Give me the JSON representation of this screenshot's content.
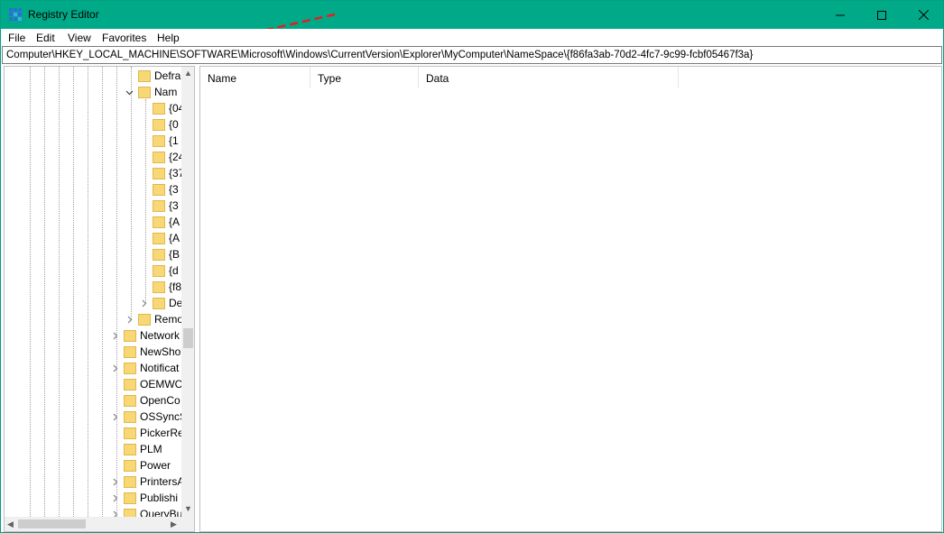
{
  "window": {
    "title": "Registry Editor",
    "titlebar_color": "#00aa88",
    "controls": [
      "minimize-icon",
      "maximize-icon",
      "close-icon"
    ]
  },
  "menu": {
    "items": [
      "File",
      "Edit",
      "View",
      "Favorites",
      "Help"
    ]
  },
  "address": {
    "path": "Computer\\HKEY_LOCAL_MACHINE\\SOFTWARE\\Microsoft\\Windows\\CurrentVersion\\Explorer\\MyComputer\\NameSpace\\{f86fa3ab-70d2-4fc7-9c99-fcbf05467f3a}"
  },
  "tree": {
    "nodes": [
      {
        "label": "Defra"
      },
      {
        "label": "Nam"
      },
      {
        "label": "{04"
      },
      {
        "label": "{0"
      },
      {
        "label": "{1"
      },
      {
        "label": "{24"
      },
      {
        "label": "{37"
      },
      {
        "label": "{3"
      },
      {
        "label": "{3"
      },
      {
        "label": "{A"
      },
      {
        "label": "{A"
      },
      {
        "label": "{B"
      },
      {
        "label": "{d"
      },
      {
        "label": "{f8"
      },
      {
        "label": "De"
      },
      {
        "label": "Remo"
      },
      {
        "label": "Network"
      },
      {
        "label": "NewSho"
      },
      {
        "label": "Notificat"
      },
      {
        "label": "OEMWC"
      },
      {
        "label": "OpenCo"
      },
      {
        "label": "OSSyncS"
      },
      {
        "label": "PickerRe"
      },
      {
        "label": "PLM"
      },
      {
        "label": "Power"
      },
      {
        "label": "PrintersA"
      },
      {
        "label": "Publishi"
      },
      {
        "label": "QueryBu"
      }
    ]
  },
  "list": {
    "columns": [
      "Name",
      "Type",
      "Data"
    ]
  },
  "annotation": {
    "color": "#e02020",
    "icon": "dashed-arrow-icon"
  }
}
